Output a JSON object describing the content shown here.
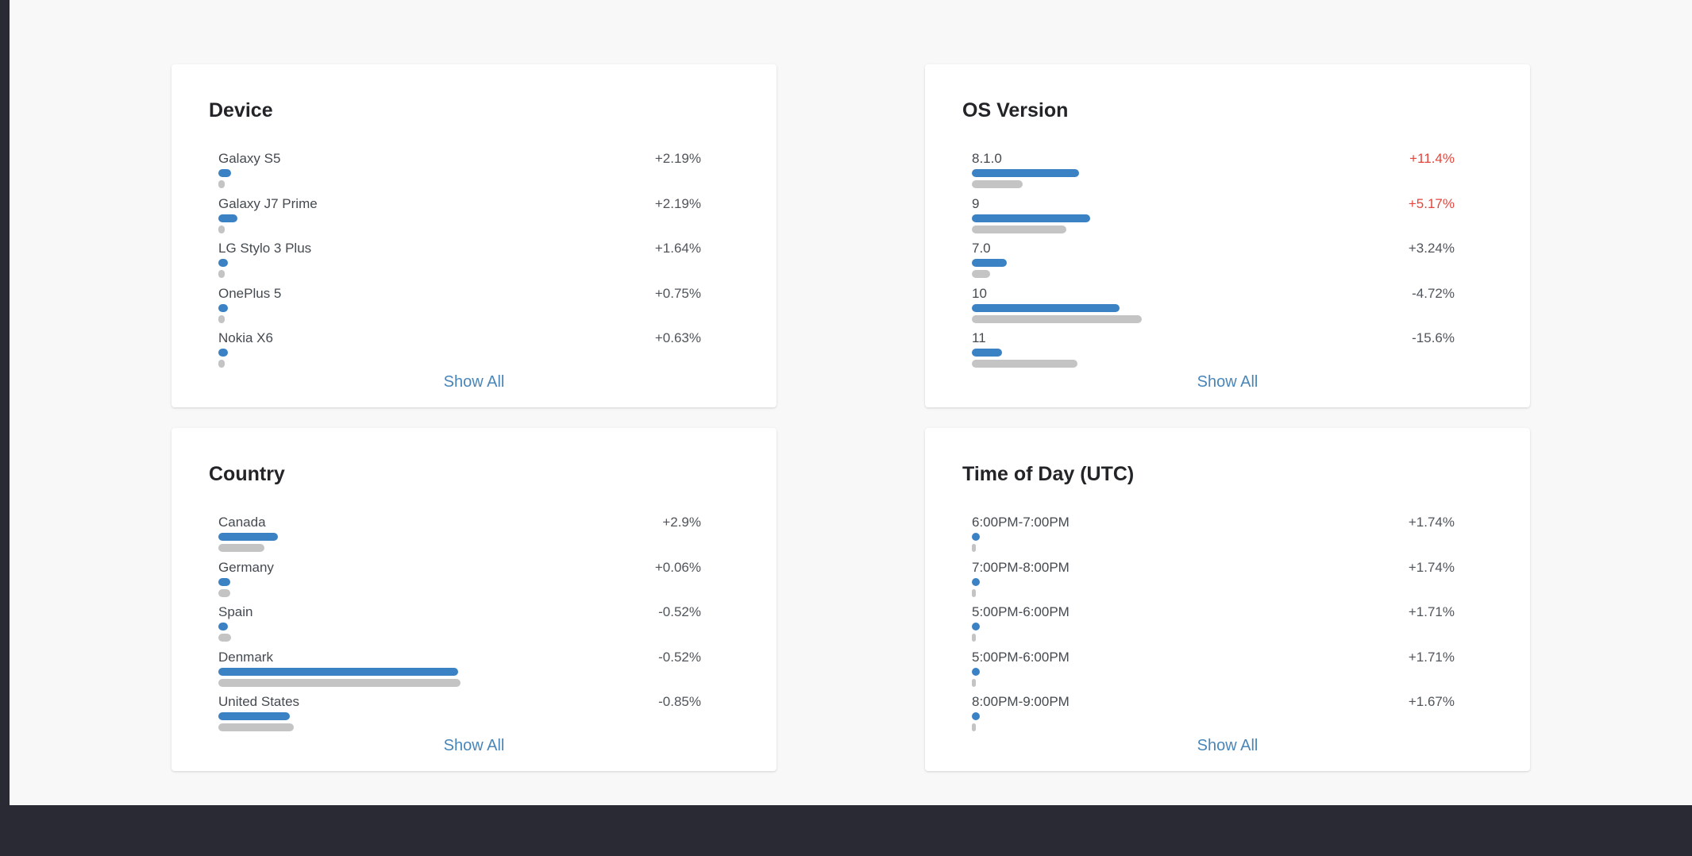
{
  "colors": {
    "current_bar": "#3b82c4",
    "previous_bar": "#c4c4c4",
    "link": "#4a86b8",
    "highlight_change": "#e3453c"
  },
  "show_all_label": "Show All",
  "cards": [
    {
      "title": "Device",
      "rows": [
        {
          "label": "Galaxy S5",
          "change": "+2.19%",
          "highlight": false,
          "current": 0.027,
          "previous": 0.005
        },
        {
          "label": "Galaxy J7 Prime",
          "change": "+2.19%",
          "highlight": false,
          "current": 0.04,
          "previous": 0.012
        },
        {
          "label": "LG Stylo 3 Plus",
          "change": "+1.64%",
          "highlight": false,
          "current": 0.02,
          "previous": 0.005
        },
        {
          "label": "OnePlus 5",
          "change": "+0.75%",
          "highlight": false,
          "current": 0.02,
          "previous": 0.01
        },
        {
          "label": "Nokia X6",
          "change": "+0.63%",
          "highlight": false,
          "current": 0.02,
          "previous": 0.01
        }
      ]
    },
    {
      "title": "OS Version",
      "rows": [
        {
          "label": "8.1.0",
          "change": "+11.4%",
          "highlight": true,
          "current": 0.222,
          "previous": 0.106
        },
        {
          "label": "9",
          "change": "+5.17%",
          "highlight": true,
          "current": 0.245,
          "previous": 0.195
        },
        {
          "label": "7.0",
          "change": "+3.24%",
          "highlight": false,
          "current": 0.073,
          "previous": 0.038
        },
        {
          "label": "10",
          "change": "-4.72%",
          "highlight": false,
          "current": 0.306,
          "previous": 0.352
        },
        {
          "label": "11",
          "change": "-15.6%",
          "highlight": false,
          "current": 0.062,
          "previous": 0.219
        }
      ]
    },
    {
      "title": "Country",
      "rows": [
        {
          "label": "Canada",
          "change": "+2.9%",
          "highlight": false,
          "current": 0.124,
          "previous": 0.095
        },
        {
          "label": "Germany",
          "change": "+0.06%",
          "highlight": false,
          "current": 0.024,
          "previous": 0.024
        },
        {
          "label": "Spain",
          "change": "-0.52%",
          "highlight": false,
          "current": 0.02,
          "previous": 0.026
        },
        {
          "label": "Denmark",
          "change": "-0.52%",
          "highlight": false,
          "current": 0.497,
          "previous": 0.502
        },
        {
          "label": "United States",
          "change": "-0.85%",
          "highlight": false,
          "current": 0.148,
          "previous": 0.157
        }
      ]
    },
    {
      "title": "Time of Day (UTC)",
      "rows": [
        {
          "label": "6:00PM-7:00PM",
          "change": "+1.74%",
          "highlight": false,
          "current": 0.017,
          "previous": 0.005
        },
        {
          "label": "7:00PM-8:00PM",
          "change": "+1.74%",
          "highlight": false,
          "current": 0.017,
          "previous": 0.005
        },
        {
          "label": "5:00PM-6:00PM",
          "change": "+1.71%",
          "highlight": false,
          "current": 0.017,
          "previous": 0.005
        },
        {
          "label": "5:00PM-6:00PM",
          "change": "+1.71%",
          "highlight": false,
          "current": 0.017,
          "previous": 0.005
        },
        {
          "label": "8:00PM-9:00PM",
          "change": "+1.67%",
          "highlight": false,
          "current": 0.017,
          "previous": 0.005
        }
      ]
    }
  ]
}
